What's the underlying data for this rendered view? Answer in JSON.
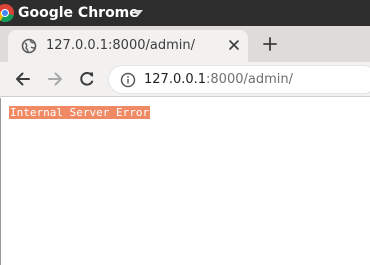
{
  "system_bar": {
    "app_name": "Google Chrome",
    "app_icon": "chrome-logo-icon",
    "menu_icon": "caret-down-icon"
  },
  "tab": {
    "title": "127.0.0.1:8000/admin/",
    "favicon": "globe-icon",
    "close_icon": "close-icon"
  },
  "new_tab_icon": "plus-icon",
  "toolbar": {
    "back_icon": "arrow-left-icon",
    "forward_icon": "arrow-right-icon",
    "reload_icon": "reload-icon",
    "info_icon": "info-icon",
    "url_host": "127.0.0.1",
    "url_rest": ":8000/admin/"
  },
  "page": {
    "error_message": "Internal Server Error"
  },
  "colors": {
    "system_bar_bg": "#2d2d2d",
    "tabstrip_bg": "#dedbd9",
    "active_tab_bg": "#f2f1f0",
    "error_highlight": "#f08a65"
  }
}
